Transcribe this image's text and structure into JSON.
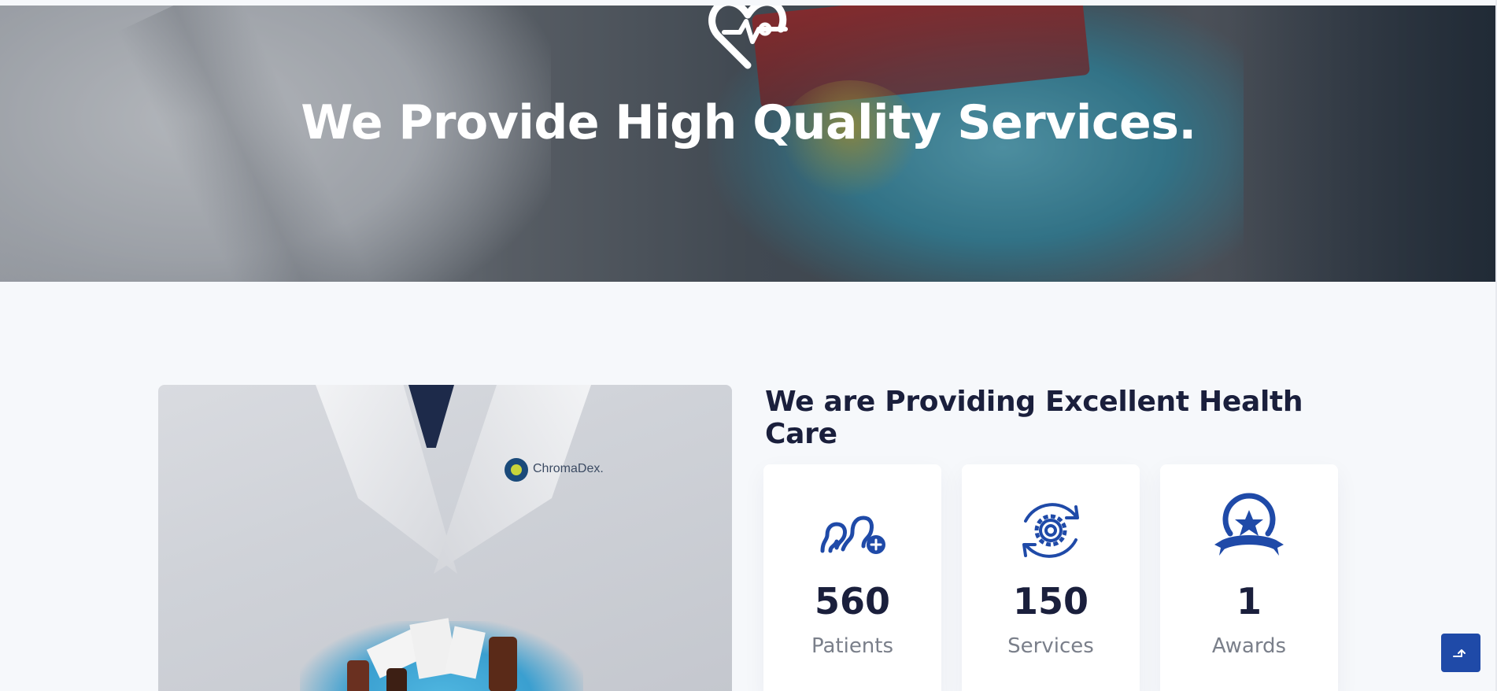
{
  "hero": {
    "title": "We Provide High Quality Services.",
    "icon": "heart-pulse-icon"
  },
  "about": {
    "title": "We are Providing Excellent Health Care",
    "photo_logo_text": "ChromaDex."
  },
  "stats": [
    {
      "icon": "patients-icon",
      "value": "560",
      "label": "Patients"
    },
    {
      "icon": "services-gear-icon",
      "value": "150",
      "label": "Services"
    },
    {
      "icon": "award-medal-icon",
      "value": "1",
      "label": "Awards"
    }
  ],
  "back_to_top": {
    "icon": "arrow-up-icon"
  },
  "colors": {
    "accent": "#1f4aa8",
    "heading": "#1a1f3c",
    "muted": "#7a7f8a",
    "background": "#f6f8fb"
  }
}
